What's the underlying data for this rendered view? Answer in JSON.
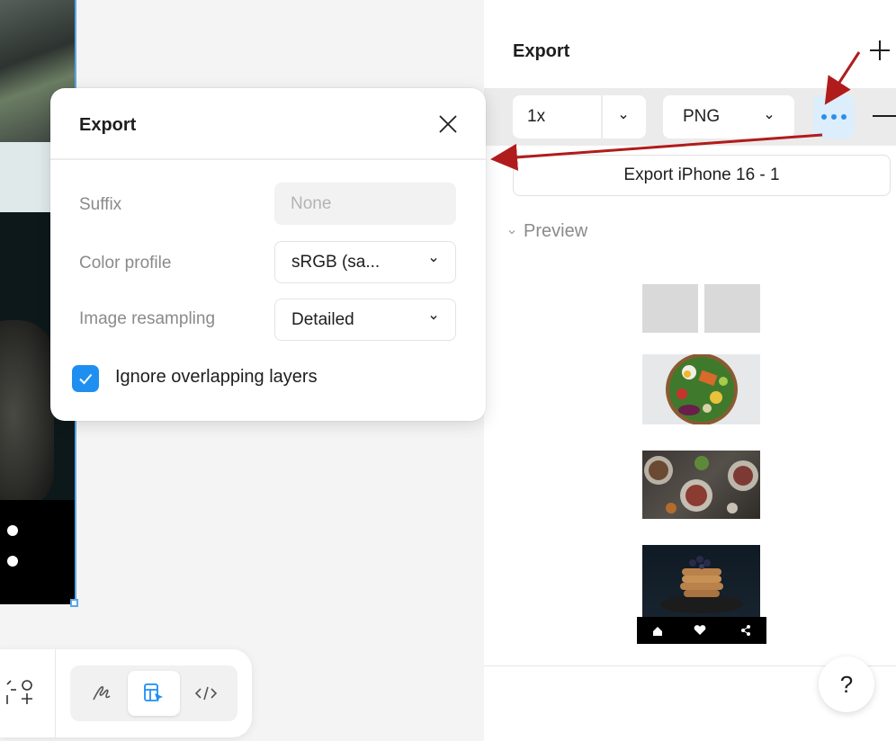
{
  "popup": {
    "title": "Export",
    "suffix_label": "Suffix",
    "suffix_placeholder": "None",
    "color_profile_label": "Color profile",
    "color_profile_value": "sRGB (sa...",
    "resampling_label": "Image resampling",
    "resampling_value": "Detailed",
    "ignore_overlapping_label": "Ignore overlapping layers",
    "ignore_overlapping_checked": true
  },
  "panel": {
    "title": "Export",
    "scale_value": "1x",
    "format_value": "PNG",
    "export_button_label": "Export iPhone 16 - 1",
    "preview_label": "Preview",
    "help_label": "?"
  },
  "colors": {
    "accent": "#1e8ff0",
    "more_button_bg": "#dcedfb",
    "annotation_arrow": "#b01c1c",
    "selection": "#5aa7e8"
  },
  "icons": {
    "close": "close-icon",
    "plus": "plus-icon",
    "minus": "minus-icon",
    "more": "more-horizontal-icon",
    "chevron": "chevron-down-icon",
    "check": "check-icon",
    "draw": "pen-icon",
    "design": "design-mode-icon",
    "dev": "code-icon",
    "components": "components-icon"
  },
  "toolbar": {
    "modes": [
      "draw",
      "design",
      "dev"
    ],
    "active_mode": "design"
  }
}
